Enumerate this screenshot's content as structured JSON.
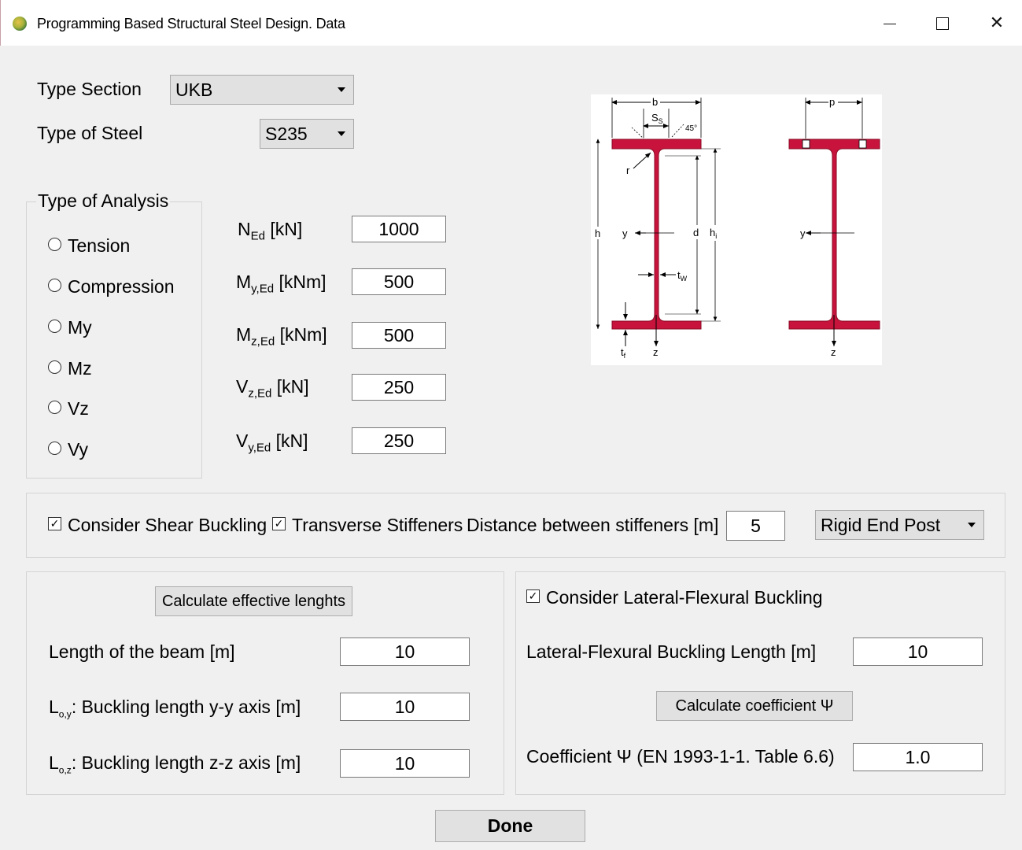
{
  "window": {
    "title": "Programming Based Structural Steel Design. Data",
    "controls": [
      "minimize",
      "maximize",
      "close"
    ]
  },
  "section": {
    "type_label": "Type Section",
    "type_value": "UKB",
    "steel_label": "Type of Steel",
    "steel_value": "S235"
  },
  "analysis": {
    "legend": "Type of Analysis",
    "options": [
      "Tension",
      "Compression",
      "My",
      "Mz",
      "Vz",
      "Vy"
    ]
  },
  "loads": [
    {
      "sym": "N",
      "sub": "Ed",
      "unit": "[kN]",
      "value": "1000"
    },
    {
      "sym": "M",
      "sub": "y,Ed",
      "unit": "[kNm]",
      "value": "500"
    },
    {
      "sym": "M",
      "sub": "z,Ed",
      "unit": "[kNm]",
      "value": "500"
    },
    {
      "sym": "V",
      "sub": "z,Ed",
      "unit": "[kN]",
      "value": "250"
    },
    {
      "sym": "V",
      "sub": "y,Ed",
      "unit": "[kN]",
      "value": "250"
    }
  ],
  "diagram": {
    "labels": {
      "b": "b",
      "ss": "S",
      "ss_sub": "S",
      "angle": "45°",
      "r": "r",
      "h": "h",
      "y": "y",
      "d": "d",
      "hi": "h",
      "hi_sub": "i",
      "tw": "t",
      "tw_sub": "W",
      "tf": "t",
      "tf_sub": "f",
      "z": "z",
      "p": "p",
      "y2": "y",
      "z2": "z"
    },
    "fill_color": "#c8143c"
  },
  "shear": {
    "consider_label": "Consider Shear Buckling",
    "consider_checked": true,
    "stiffeners_label": "Transverse Stiffeners",
    "stiffeners_checked": true,
    "distance_label": "Distance between stiffeners [m]",
    "distance_value": "5",
    "end_post_value": "Rigid End Post"
  },
  "lengths": {
    "calc_button": "Calculate effective lenghts",
    "beam_label": "Length of the beam [m]",
    "beam_value": "10",
    "loy_sym": "L",
    "loy_sub": "o,y",
    "loy_label": ": Buckling length y-y axis [m]",
    "loy_value": "10",
    "loz_sym": "L",
    "loz_sub": "o,z",
    "loz_label": ": Buckling length z-z axis [m]",
    "loz_value": "10"
  },
  "ltb": {
    "consider_label": "Consider Lateral-Flexural Buckling",
    "consider_checked": true,
    "length_label": "Lateral-Flexural Buckling Length [m]",
    "length_value": "10",
    "calc_button": "Calculate coefficient Ψ",
    "coef_label": "Coefficient Ψ (EN 1993-1-1. Table 6.6)",
    "coef_value": "1.0"
  },
  "done_button": "Done",
  "colors": {
    "background": "#f0f0f0",
    "button": "#e1e1e1",
    "section_fill": "#c8143c"
  }
}
